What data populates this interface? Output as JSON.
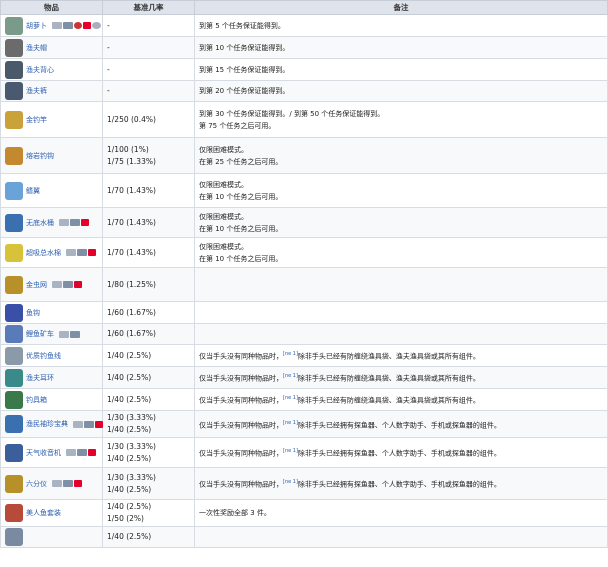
{
  "headers": {
    "item": "物品",
    "rate": "基准几率",
    "note": "备注"
  },
  "rows": [
    {
      "name": "胡萝卜",
      "icon": "carrot-icon",
      "color": "#7a9a8a",
      "plats": [
        "pc",
        "con",
        "ext",
        "ns",
        "old"
      ],
      "rates": [
        "-"
      ],
      "notes": [
        "到第 5 个任务保证能得到。"
      ]
    },
    {
      "name": "渔夫帽",
      "icon": "hat-icon",
      "color": "#6b6b6b",
      "plats": [],
      "rates": [
        "-"
      ],
      "notes": [
        "到第 10 个任务保证能得到。"
      ]
    },
    {
      "name": "渔夫背心",
      "icon": "vest-icon",
      "color": "#4a5a6a",
      "plats": [],
      "rates": [
        "-"
      ],
      "notes": [
        "到第 15 个任务保证能得到。"
      ]
    },
    {
      "name": "渔夫裤",
      "icon": "pants-icon",
      "color": "#4a5870",
      "plats": [],
      "rates": [
        "-"
      ],
      "notes": [
        "到第 20 个任务保证能得到。"
      ]
    },
    {
      "name": "金钓竿",
      "icon": "golden-rod-icon",
      "color": "#c9a23a",
      "plats": [],
      "rates": [
        "1/250 (0.4%)"
      ],
      "notes": [
        "到第 30 个任务保证能得到。",
        "/ 到第 50 个任务保证能得到。",
        "第 75 个任务之后可用。"
      ]
    },
    {
      "name": "熔岩钓钩",
      "icon": "hook-icon",
      "color": "#c4882e",
      "plats": [],
      "rates": [
        "1/100 (1%)",
        "1/75 (1.33%)"
      ],
      "notes": [
        "仅限困难模式。",
        "在第 25 个任务之后可用。"
      ]
    },
    {
      "name": "鳍翼",
      "icon": "wings-icon",
      "color": "#6aa3d8",
      "plats": [],
      "rates": [
        "1/70 (1.43%)"
      ],
      "notes": [
        "仅限困难模式。",
        "在第 10 个任务之后可用。"
      ]
    },
    {
      "name": "无底水桶",
      "icon": "bucket-icon",
      "color": "#3a6fb0",
      "plats": [
        "pc",
        "con",
        "ns"
      ],
      "rates": [
        "1/70 (1.43%)"
      ],
      "notes": [
        "仅限困难模式。",
        "在第 10 个任务之后可用。"
      ]
    },
    {
      "name": "超吸总水棉",
      "icon": "sponge-icon",
      "color": "#d8c23a",
      "plats": [
        "pc",
        "con",
        "ns"
      ],
      "rates": [
        "1/70 (1.43%)"
      ],
      "notes": [
        "仅限困难模式。",
        "在第 10 个任务之后可用。"
      ]
    },
    {
      "name": "金虫网",
      "icon": "bug-net-icon",
      "color": "#b8902a",
      "plats": [
        "pc",
        "con",
        "ns"
      ],
      "rates": [
        "1/80 (1.25%)"
      ],
      "notes": []
    },
    {
      "name": "鱼钩",
      "icon": "fish-hook-icon",
      "color": "#3a4fa8",
      "plats": [],
      "rates": [
        "1/60 (1.67%)"
      ],
      "notes": []
    },
    {
      "name": "鲤鱼矿车",
      "icon": "minecart-icon",
      "color": "#5a7ab8",
      "plats": [
        "pc",
        "con"
      ],
      "rates": [
        "1/60 (1.67%)"
      ],
      "notes": []
    },
    {
      "name": "优质钓鱼线",
      "icon": "fishing-line-icon",
      "color": "#8a9aa8",
      "plats": [],
      "rates": [
        "1/40 (2.5%)"
      ],
      "notes": [
        "仅当手头没有同种物品时，",
        "[ne 1]",
        "除非手头已经有防缠绕渔具袋、渔夫渔具袋或其所有组件。"
      ]
    },
    {
      "name": "渔夫耳环",
      "icon": "earring-icon",
      "color": "#3a8a8a",
      "plats": [],
      "rates": [
        "1/40 (2.5%)"
      ],
      "notes": [
        "仅当手头没有同种物品时，",
        "[ne 1]",
        "除非手头已经有防缠绕渔具袋、渔夫渔具袋或其所有组件。"
      ]
    },
    {
      "name": "钓具箱",
      "icon": "tackle-box-icon",
      "color": "#3a7a4a",
      "plats": [],
      "rates": [
        "1/40 (2.5%)"
      ],
      "notes": [
        "仅当手头没有同种物品时，",
        "[ne 1]",
        "除非手头已经有防缠绕渔具袋、渔夫渔具袋或其所有组件。"
      ]
    },
    {
      "name": "渔民袖珍宝典",
      "icon": "guide-icon",
      "color": "#3a6fb0",
      "plats": [
        "pc",
        "con",
        "ns"
      ],
      "rates": [
        "1/30 (3.33%)",
        "1/40 (2.5%)"
      ],
      "notes": [
        "仅当手头没有同种物品时，",
        "[ne 1]",
        "除非手头已经拥有探鱼器、个人数字助手、手机或探鱼器的组件。"
      ]
    },
    {
      "name": "天气收音机",
      "icon": "radio-icon",
      "color": "#3a5f9a",
      "plats": [
        "pc",
        "con",
        "ns"
      ],
      "rates": [
        "1/30 (3.33%)",
        "1/40 (2.5%)"
      ],
      "notes": [
        "仅当手头没有同种物品时，",
        "[ne 1]",
        "除非手头已经拥有探鱼器、个人数字助手、手机或探鱼器的组件。"
      ]
    },
    {
      "name": "六分仪",
      "icon": "sextant-icon",
      "color": "#b8902a",
      "plats": [
        "pc",
        "con",
        "ns"
      ],
      "rates": [
        "1/30 (3.33%)",
        "1/40 (2.5%)"
      ],
      "notes": [
        "仅当手头没有同种物品时，",
        "[ne 1]",
        "除非手头已经拥有探鱼器、个人数字助手、手机或探鱼器的组件。"
      ]
    },
    {
      "name": "美人鱼套装",
      "icon": "mermaid-icon",
      "color": "#b84a3a",
      "plats": [],
      "rates": [
        "1/40 (2.5%)",
        "1/50 (2%)"
      ],
      "notes": [
        "一次性奖励全部 3 件。"
      ]
    },
    {
      "name": "",
      "icon": "partial-icon",
      "color": "#7a8aa0",
      "plats": [],
      "rates": [
        "1/40 (2.5%)"
      ],
      "notes": []
    }
  ]
}
